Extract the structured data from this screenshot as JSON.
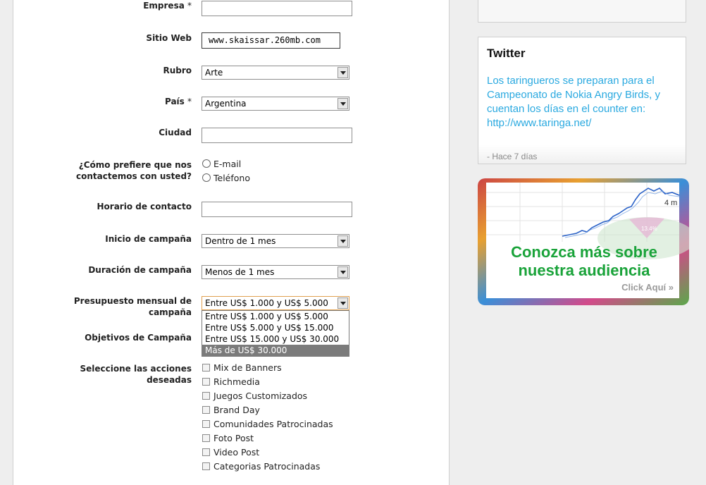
{
  "form": {
    "company": {
      "label": "Empresa",
      "required_mark": "*",
      "value": ""
    },
    "website": {
      "label": "Sitio Web",
      "value": "www.skaissar.260mb.com"
    },
    "industry": {
      "label": "Rubro",
      "selected": "Arte"
    },
    "country": {
      "label": "País",
      "required_mark": "*",
      "selected": "Argentina"
    },
    "city": {
      "label": "Ciudad",
      "value": ""
    },
    "contact_pref": {
      "label_line1": "¿Cómo prefiere que nos",
      "label_line2": "contactemos con usted?",
      "options": [
        "E-mail",
        "Teléfono"
      ]
    },
    "contact_hours": {
      "label": "Horario de contacto",
      "value": ""
    },
    "campaign_start": {
      "label": "Inicio de campaña",
      "selected": "Dentro de 1 mes"
    },
    "campaign_duration": {
      "label": "Duración de campaña",
      "selected": "Menos de 1 mes"
    },
    "monthly_budget": {
      "label_line1": "Presupuesto mensual de",
      "label_line2": "campaña",
      "selected": "Entre US$ 1.000 y US$ 5.000",
      "options": [
        "Entre US$ 1.000 y US$ 5.000",
        "Entre US$ 5.000 y US$ 15.000",
        "Entre US$ 15.000 y US$ 30.000",
        "Más de US$ 30.000"
      ],
      "highlighted_option": "Más de US$ 30.000"
    },
    "campaign_goals": {
      "label": "Objetivos de Campaña"
    },
    "actions": {
      "label_line1": "Seleccione las acciones",
      "label_line2": "deseadas",
      "options": [
        "Mix de Banners",
        "Richmedia",
        "Juegos Customizados",
        "Brand Day",
        "Comunidades Patrocinadas",
        "Foto Post",
        "Video Post",
        "Categorias Patrocinadas"
      ]
    }
  },
  "twitter": {
    "title": "Twitter",
    "tweet": "Los taringueros se preparan para el Campeonato de Nokia Angry Birds, y cuentan los días en el counter en: http://www.taringa.net/",
    "time": "- Hace 7 días"
  },
  "ad": {
    "headline_line1": "Conozca más sobre",
    "headline_line2": "nuestra audiencia",
    "cta": "Click Aquí »",
    "axis_label": "4 m",
    "pie_label": "13.4%"
  },
  "colors": {
    "twitter_link": "#2aa9e0",
    "ad_green": "#1aa33a",
    "dropdown_highlight": "#7b7b7b",
    "focus_border": "#e0a050"
  }
}
